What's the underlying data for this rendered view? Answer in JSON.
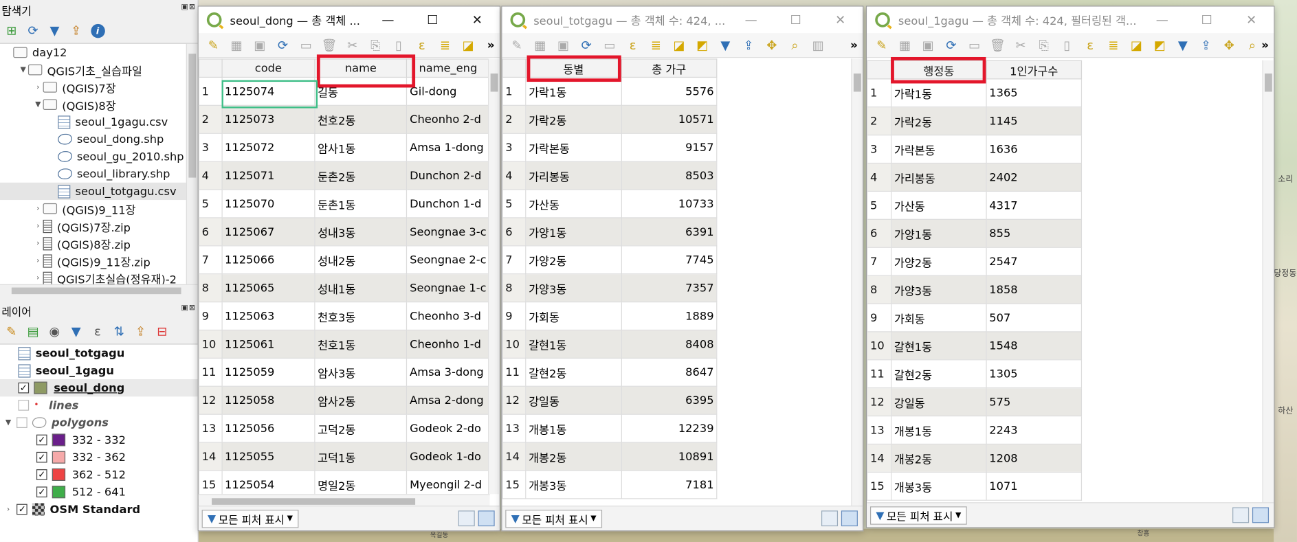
{
  "browser": {
    "title": "탐색기",
    "tree": [
      {
        "label": "day12",
        "indent": 0,
        "icon": "folder",
        "arrow": ""
      },
      {
        "label": "QGIS기초_실습파일",
        "indent": 1,
        "icon": "folder",
        "arrow": "▼"
      },
      {
        "label": "(QGIS)7장",
        "indent": 2,
        "icon": "folder",
        "arrow": "›"
      },
      {
        "label": "(QGIS)8장",
        "indent": 2,
        "icon": "folder",
        "arrow": "▼"
      },
      {
        "label": "seoul_1gagu.csv",
        "indent": 3,
        "icon": "csv",
        "arrow": ""
      },
      {
        "label": "seoul_dong.shp",
        "indent": 3,
        "icon": "shp",
        "arrow": ""
      },
      {
        "label": "seoul_gu_2010.shp",
        "indent": 3,
        "icon": "shp",
        "arrow": ""
      },
      {
        "label": "seoul_library.shp",
        "indent": 3,
        "icon": "shp",
        "arrow": ""
      },
      {
        "label": "seoul_totgagu.csv",
        "indent": 3,
        "icon": "csv",
        "arrow": "",
        "selected": true
      },
      {
        "label": "(QGIS)9_11장",
        "indent": 2,
        "icon": "folder",
        "arrow": "›"
      },
      {
        "label": "(QGIS)7장.zip",
        "indent": 2,
        "icon": "zip",
        "arrow": "›"
      },
      {
        "label": "(QGIS)8장.zip",
        "indent": 2,
        "icon": "zip",
        "arrow": "›"
      },
      {
        "label": "(QGIS)9_11장.zip",
        "indent": 2,
        "icon": "zip",
        "arrow": "›"
      },
      {
        "label": "QGIS기초실습(정유재)-2",
        "indent": 2,
        "icon": "zip",
        "arrow": "›"
      }
    ]
  },
  "layers": {
    "title": "레이어",
    "items": [
      {
        "label": "seoul_totgagu",
        "type": "table",
        "bold": true
      },
      {
        "label": "seoul_1gagu",
        "type": "table",
        "bold": true
      },
      {
        "label": "seoul_dong",
        "type": "polygon",
        "bold": true,
        "checked": true,
        "underline": true
      },
      {
        "label": "lines",
        "type": "line",
        "italic": true,
        "checked": false
      },
      {
        "label": "polygons",
        "type": "group",
        "italic": true,
        "checked": false
      },
      {
        "label": "332 - 332",
        "type": "class",
        "color": "#6a1f8a",
        "checked": true
      },
      {
        "label": "332 - 362",
        "type": "class",
        "color": "#f6a9a9",
        "checked": true
      },
      {
        "label": "362 - 512",
        "type": "class",
        "color": "#ee4444",
        "checked": true
      },
      {
        "label": "512 - 641",
        "type": "class",
        "color": "#3fae4a",
        "checked": true
      },
      {
        "label": "OSM Standard",
        "type": "raster",
        "bold": true,
        "checked": true
      }
    ]
  },
  "win1": {
    "title": "seoul_dong — 총 객체 ...",
    "columns": [
      "code",
      "name",
      "name_eng"
    ],
    "rows": [
      [
        "1",
        "1125074",
        "길동",
        "Gil-dong"
      ],
      [
        "2",
        "1125073",
        "천호2동",
        "Cheonho 2-d"
      ],
      [
        "3",
        "1125072",
        "암사1동",
        "Amsa 1-dong"
      ],
      [
        "4",
        "1125071",
        "둔촌2동",
        "Dunchon 2-d"
      ],
      [
        "5",
        "1125070",
        "둔촌1동",
        "Dunchon 1-d"
      ],
      [
        "6",
        "1125067",
        "성내3동",
        "Seongnae 3-c"
      ],
      [
        "7",
        "1125066",
        "성내2동",
        "Seongnae 2-c"
      ],
      [
        "8",
        "1125065",
        "성내1동",
        "Seongnae 1-c"
      ],
      [
        "9",
        "1125063",
        "천호3동",
        "Cheonho 3-d"
      ],
      [
        "10",
        "1125061",
        "천호1동",
        "Cheonho 1-d"
      ],
      [
        "11",
        "1125059",
        "암사3동",
        "Amsa 3-dong"
      ],
      [
        "12",
        "1125058",
        "암사2동",
        "Amsa 2-dong"
      ],
      [
        "13",
        "1125056",
        "고덕2동",
        "Godeok 2-do"
      ],
      [
        "14",
        "1125055",
        "고덕1동",
        "Godeok 1-do"
      ],
      [
        "15",
        "1125054",
        "명일2동",
        "Myeongil 2-d"
      ]
    ],
    "show_all": "모든 피처 표시"
  },
  "win2": {
    "title": "seoul_totgagu — 총 객체 수: 424, ...",
    "columns": [
      "동별",
      "총 가구"
    ],
    "rows": [
      [
        "1",
        "가락1동",
        "5576"
      ],
      [
        "2",
        "가락2동",
        "10571"
      ],
      [
        "3",
        "가락본동",
        "9157"
      ],
      [
        "4",
        "가리봉동",
        "8503"
      ],
      [
        "5",
        "가산동",
        "10733"
      ],
      [
        "6",
        "가양1동",
        "6391"
      ],
      [
        "7",
        "가양2동",
        "7745"
      ],
      [
        "8",
        "가양3동",
        "7357"
      ],
      [
        "9",
        "가회동",
        "1889"
      ],
      [
        "10",
        "갈현1동",
        "8408"
      ],
      [
        "11",
        "갈현2동",
        "8647"
      ],
      [
        "12",
        "강일동",
        "6395"
      ],
      [
        "13",
        "개봉1동",
        "12239"
      ],
      [
        "14",
        "개봉2동",
        "10891"
      ],
      [
        "15",
        "개봉3동",
        "7181"
      ]
    ],
    "show_all": "모든 피처 표시"
  },
  "win3": {
    "title": "seoul_1gagu — 총 객체 수: 424, 필터링된 객...",
    "columns": [
      "행정동",
      "1인가구수"
    ],
    "rows": [
      [
        "1",
        "가락1동",
        "1365"
      ],
      [
        "2",
        "가락2동",
        "1145"
      ],
      [
        "3",
        "가락본동",
        "1636"
      ],
      [
        "4",
        "가리봉동",
        "2402"
      ],
      [
        "5",
        "가산동",
        "4317"
      ],
      [
        "6",
        "가양1동",
        "855"
      ],
      [
        "7",
        "가양2동",
        "2547"
      ],
      [
        "8",
        "가양3동",
        "1858"
      ],
      [
        "9",
        "가회동",
        "507"
      ],
      [
        "10",
        "갈현1동",
        "1548"
      ],
      [
        "11",
        "갈현2동",
        "1305"
      ],
      [
        "12",
        "강일동",
        "575"
      ],
      [
        "13",
        "개봉1동",
        "2243"
      ],
      [
        "14",
        "개봉2동",
        "1208"
      ],
      [
        "15",
        "개봉3동",
        "1071"
      ]
    ],
    "show_all": "모든 피처 표시"
  },
  "map_labels": [
    "소리",
    "당정동",
    "하산",
    "창흥",
    "옥길동"
  ],
  "colors": {
    "highlight": "#e3162b",
    "focus": "#3fbf88",
    "qgis_green": "#77a94a"
  }
}
